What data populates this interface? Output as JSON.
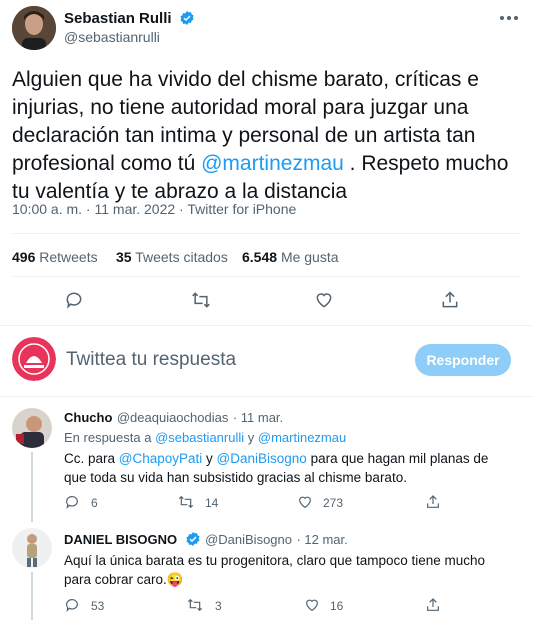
{
  "tweet": {
    "author_name": "Sebastian Rulli",
    "author_handle": "@sebastianrulli",
    "text_part1": "Alguien que ha vivido del chisme barato, críticas e injurias, no tiene autoridad moral para juzgar una declaración tan intima y personal de un artista tan profesional como tú ",
    "mention": "@martinezmau",
    "text_part2": " . Respeto mucho tu valentía y te abrazo a la distancia",
    "timestamp": "10:00 a. m. · 11 mar. 2022 · Twitter for iPhone",
    "retweets_count": "496",
    "retweets_label": "Retweets",
    "quotes_count": "35",
    "quotes_label": "Tweets citados",
    "likes_count": "6.548",
    "likes_label": "Me gusta"
  },
  "compose": {
    "placeholder": "Twittea tu respuesta",
    "reply_button": "Responder"
  },
  "replies": [
    {
      "name": "Chucho",
      "handle": "@deaquiaochodias",
      "date": "· 11 mar.",
      "reply_to_prefix": "En respuesta a ",
      "reply_to_1": "@sebastianrulli",
      "reply_to_joiner": " y ",
      "reply_to_2": "@martinezmau",
      "text_a": "Cc. para ",
      "mention_a": "@ChapoyPati",
      "text_b": " y ",
      "mention_b": "@DaniBisogno",
      "text_c": " para que hagan mil planas de que toda su vida han subsistido gracias al chisme barato.",
      "replies_count": "6",
      "retweets_count": "14",
      "likes_count": "273"
    },
    {
      "name": "DANIEL BISOGNO",
      "handle": "@DaniBisogno",
      "date": "· 12 mar.",
      "text": "Aquí la única barata es tu progenitora, claro que tampoco tiene mucho para cobrar caro.",
      "emoji": "😜",
      "replies_count": "53",
      "retweets_count": "3",
      "likes_count": "16"
    }
  ],
  "colors": {
    "accent": "#1d9bf0",
    "reply_button_bg": "#8ecdf8",
    "muted_text": "#536471"
  }
}
